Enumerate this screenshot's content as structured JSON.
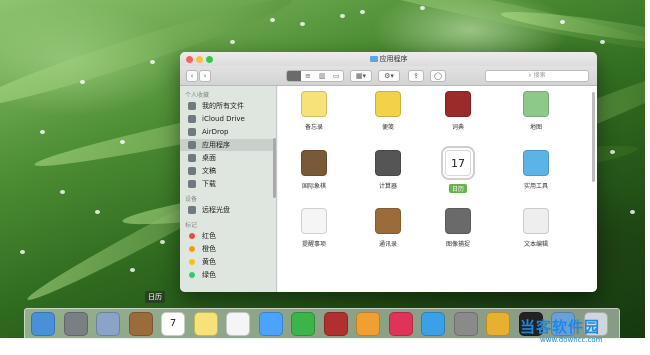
{
  "window": {
    "title": "应用程序",
    "search_placeholder": "搜索"
  },
  "sidebar": {
    "sections": [
      {
        "header": "个人收藏",
        "items": [
          {
            "label": "我的所有文件",
            "icon": "all-files-icon"
          },
          {
            "label": "iCloud Drive",
            "icon": "cloud-icon"
          },
          {
            "label": "AirDrop",
            "icon": "airdrop-icon"
          },
          {
            "label": "应用程序",
            "icon": "applications-icon",
            "selected": true
          },
          {
            "label": "桌面",
            "icon": "desktop-icon"
          },
          {
            "label": "文稿",
            "icon": "documents-icon"
          },
          {
            "label": "下载",
            "icon": "download-icon"
          }
        ]
      },
      {
        "header": "设备",
        "items": [
          {
            "label": "远程光盘",
            "icon": "disc-icon"
          }
        ]
      },
      {
        "header": "标记",
        "items": [
          {
            "label": "红色",
            "color": "#e74c3c"
          },
          {
            "label": "橙色",
            "color": "#f39c12"
          },
          {
            "label": "黄色",
            "color": "#f1c40f"
          },
          {
            "label": "绿色",
            "color": "#2ecc71"
          }
        ]
      }
    ]
  },
  "apps": [
    {
      "label": "备忘录",
      "icon": "notes-icon",
      "color": "#f7e27a"
    },
    {
      "label": "便笺",
      "icon": "stickies-icon",
      "color": "#f3d24a"
    },
    {
      "label": "词典",
      "icon": "dictionary-icon",
      "color": "#9b2a2a"
    },
    {
      "label": "地图",
      "icon": "maps-icon",
      "color": "#8ec98a"
    },
    {
      "label": "国际象棋",
      "icon": "chess-icon",
      "color": "#7a5a36"
    },
    {
      "label": "计算器",
      "icon": "calculator-icon",
      "color": "#555555"
    },
    {
      "label": "日历",
      "icon": "calendar-icon",
      "color": "#ffffff",
      "selected": true,
      "day": "17"
    },
    {
      "label": "实用工具",
      "icon": "utilities-folder-icon",
      "color": "#5cb3e8"
    },
    {
      "label": "提醒事项",
      "icon": "reminders-icon",
      "color": "#f5f5f5"
    },
    {
      "label": "通讯录",
      "icon": "contacts-icon",
      "color": "#9b6b3a"
    },
    {
      "label": "图像捕捉",
      "icon": "image-capture-icon",
      "color": "#6a6a6a"
    },
    {
      "label": "文本编辑",
      "icon": "textedit-icon",
      "color": "#eeeeee"
    }
  ],
  "dock": {
    "tooltip": "日历",
    "items": [
      {
        "icon": "finder-icon",
        "color": "#4a90d9"
      },
      {
        "icon": "launchpad-icon",
        "color": "#7a7f86"
      },
      {
        "icon": "mail-stamp-icon",
        "color": "#8aa3c7"
      },
      {
        "icon": "contacts-icon",
        "color": "#9b6b3a"
      },
      {
        "icon": "calendar-icon",
        "color": "#ffffff",
        "day": "7"
      },
      {
        "icon": "notes-icon",
        "color": "#f7e27a"
      },
      {
        "icon": "reminders-icon",
        "color": "#f5f5f5"
      },
      {
        "icon": "messages-icon",
        "color": "#4aa3ff"
      },
      {
        "icon": "facetime-icon",
        "color": "#3bb54a"
      },
      {
        "icon": "photo-booth-icon",
        "color": "#b03030"
      },
      {
        "icon": "ibooks-icon",
        "color": "#f0a030"
      },
      {
        "icon": "itunes-icon",
        "color": "#e0335a"
      },
      {
        "icon": "app-store-icon",
        "color": "#3aa0e8"
      },
      {
        "icon": "system-preferences-icon",
        "color": "#8a8a8a"
      },
      {
        "icon": "photos-icon",
        "color": "#e8b030"
      },
      {
        "icon": "qq-icon",
        "color": "#222222"
      },
      {
        "icon": "preview-icon",
        "color": "#6aa0d8"
      },
      {
        "icon": "trash-icon",
        "color": "#cfd6dc"
      }
    ]
  },
  "watermark": {
    "text": "当客软件园",
    "url": "www.downcc.com"
  }
}
